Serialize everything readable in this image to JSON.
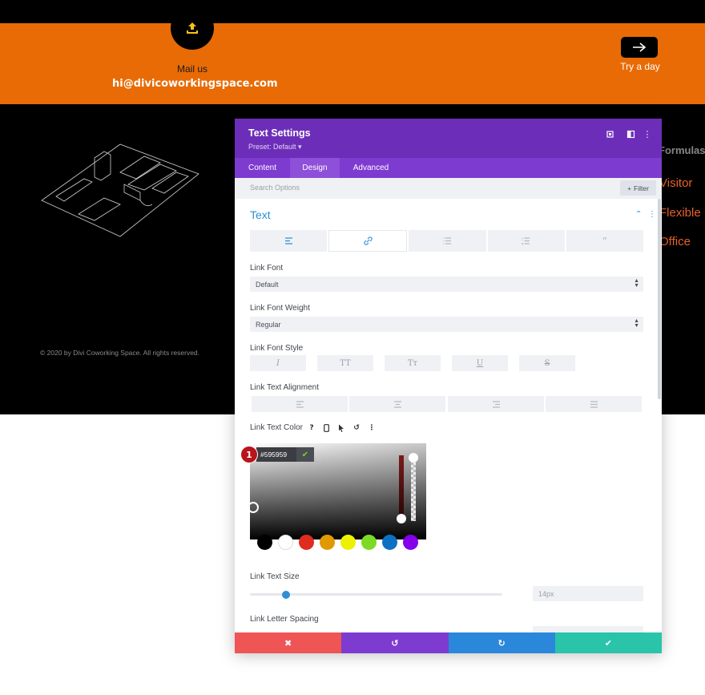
{
  "site": {
    "mail_label": "Mail us",
    "mail_address": "hi@divicoworkingspace.com",
    "try_label": "Try a day",
    "copyright": "© 2020 by Divi Coworking Space. All rights reserved.",
    "right_heading": "Formulas",
    "right_links": [
      "Visitor",
      "Flexible",
      "Office"
    ],
    "colors": {
      "orange": "#e86b06",
      "dark": "#000000",
      "link_orange": "#e8622a"
    },
    "icons": {
      "upload": "upload-icon",
      "arrow": "arrow-right-icon"
    }
  },
  "modal": {
    "title": "Text Settings",
    "preset": "Preset: Default ▾",
    "header_icons": [
      "fullscreen-icon",
      "sidebar-icon",
      "more-vertical-icon"
    ],
    "tabs": [
      {
        "label": "Content",
        "active": false
      },
      {
        "label": "Design",
        "active": true
      },
      {
        "label": "Advanced",
        "active": false
      }
    ],
    "search_placeholder": "Search Options",
    "filter_label": "Filter",
    "section_title": "Text",
    "text_tabs": [
      "align-left-icon",
      "link-icon",
      "list-icon",
      "ordered-list-icon",
      "quote-icon"
    ],
    "active_text_tab": 1,
    "link_font": {
      "label": "Link Font",
      "value": "Default"
    },
    "link_font_weight": {
      "label": "Link Font Weight",
      "value": "Regular"
    },
    "link_font_style": {
      "label": "Link Font Style",
      "buttons": [
        "I",
        "TT",
        "Tт",
        "U",
        "S"
      ]
    },
    "link_text_alignment": {
      "label": "Link Text Alignment",
      "buttons": [
        "align-left-icon",
        "align-center-icon",
        "align-right-icon",
        "align-justify-icon"
      ]
    },
    "link_text_color": {
      "label": "Link Text Color",
      "icons": [
        "help-icon",
        "mobile-icon",
        "cursor-icon",
        "reset-icon",
        "more-vertical-icon"
      ],
      "hex": "#595959",
      "step_badge": "1",
      "swatches": [
        "#000000",
        "#ffffff",
        "#e02b20",
        "#e09900",
        "#edf000",
        "#7cda24",
        "#0c71c3",
        "#8300e9"
      ]
    },
    "link_text_size": {
      "label": "Link Text Size",
      "value": "14px",
      "slider_fraction": 0.13
    },
    "link_letter_spacing": {
      "label": "Link Letter Spacing"
    },
    "footer": {
      "buttons": [
        {
          "name": "cancel",
          "icon": "✖",
          "color": "#ef5555"
        },
        {
          "name": "undo",
          "icon": "↺",
          "color": "#7e3bd0"
        },
        {
          "name": "redo",
          "icon": "↻",
          "color": "#2b87da"
        },
        {
          "name": "save",
          "icon": "✔",
          "color": "#29c4a9"
        }
      ]
    }
  }
}
